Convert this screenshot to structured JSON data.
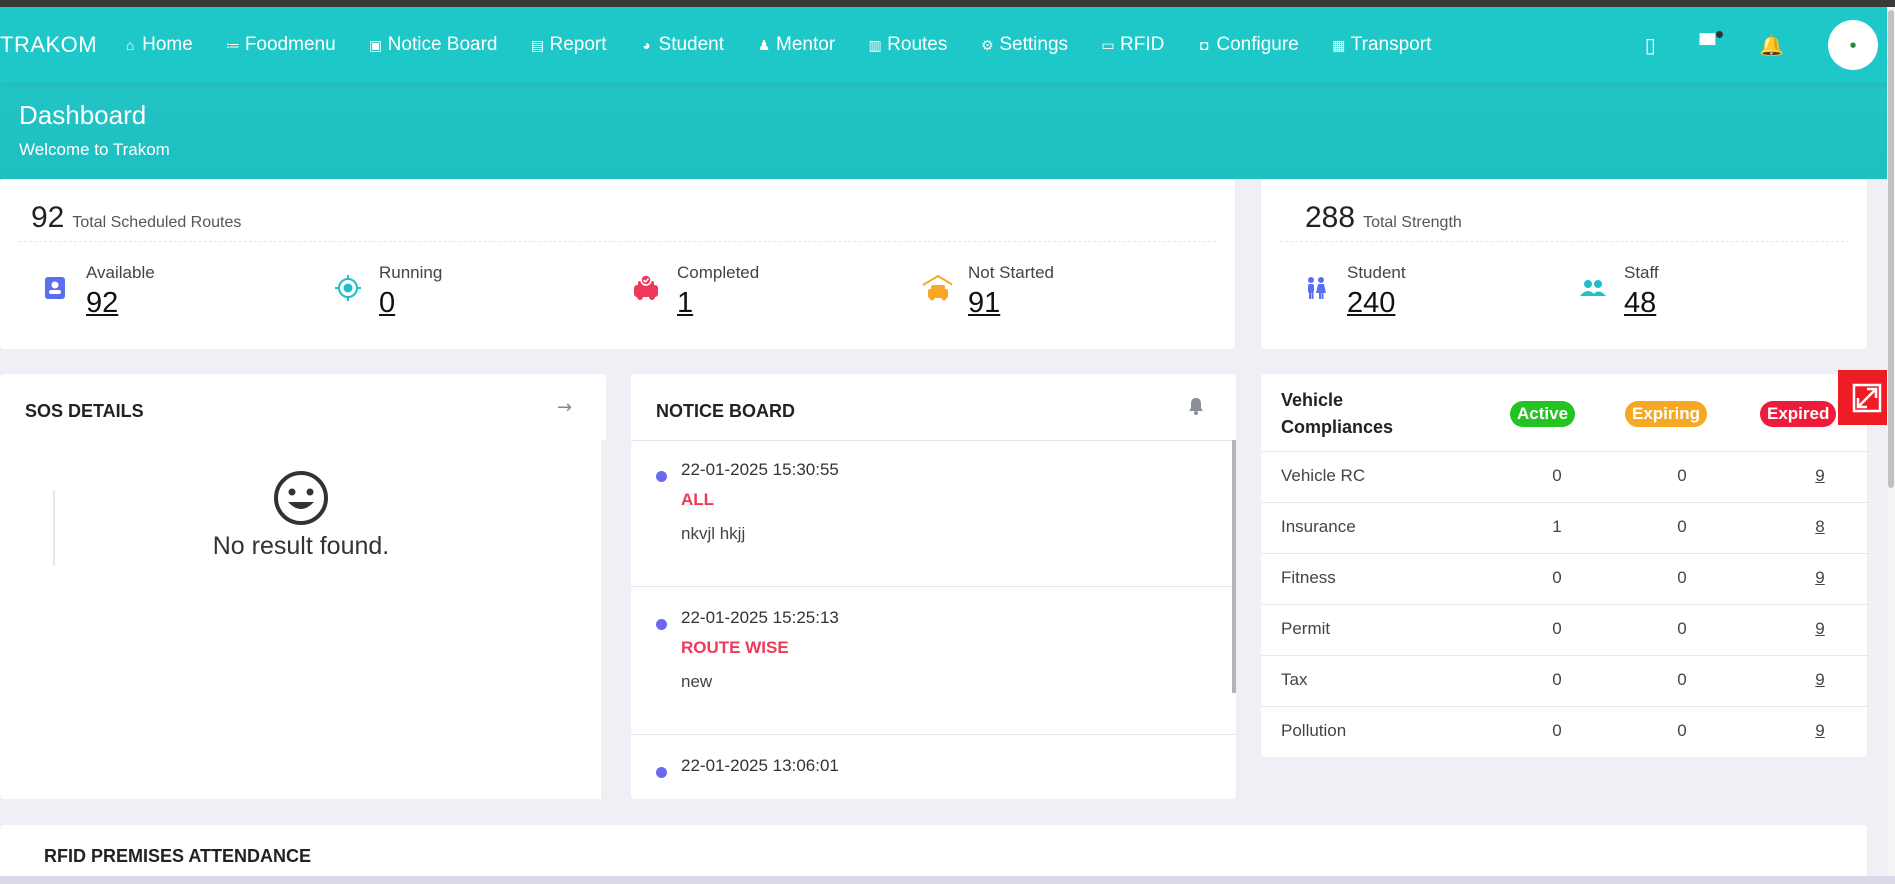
{
  "nav": {
    "brand": "TRAKOM",
    "items": [
      {
        "label": "Home",
        "icon": "home-icon",
        "glyph": "⌂"
      },
      {
        "label": "Foodmenu",
        "icon": "list-icon",
        "glyph": "≔"
      },
      {
        "label": "Notice Board",
        "icon": "id-badge-icon",
        "glyph": "▣"
      },
      {
        "label": "Report",
        "icon": "document-icon",
        "glyph": "▤"
      },
      {
        "label": "Student",
        "icon": "student-icon",
        "glyph": "◕"
      },
      {
        "label": "Mentor",
        "icon": "user-icon",
        "glyph": "♟"
      },
      {
        "label": "Routes",
        "icon": "map-icon",
        "glyph": "▥"
      },
      {
        "label": "Settings",
        "icon": "gear-icon",
        "glyph": "⚙"
      },
      {
        "label": "RFID",
        "icon": "card-icon",
        "glyph": "▭"
      },
      {
        "label": "Configure",
        "icon": "configure-icon",
        "glyph": "◘"
      },
      {
        "label": "Transport",
        "icon": "bus-icon",
        "glyph": "▦"
      }
    ]
  },
  "header": {
    "title": "Dashboard",
    "subtitle": "Welcome to Trakom"
  },
  "routes": {
    "total": "92",
    "total_label": "Total Scheduled Routes",
    "stats": [
      {
        "label": "Available",
        "value": "92",
        "icon": "badge-icon",
        "color": "#5b6ef0"
      },
      {
        "label": "Running",
        "value": "0",
        "icon": "target-icon",
        "color": "#1fc0c7"
      },
      {
        "label": "Completed",
        "value": "1",
        "icon": "car-check-icon",
        "color": "#ee3a5a"
      },
      {
        "label": "Not Started",
        "value": "91",
        "icon": "garage-icon",
        "color": "#f7a823"
      }
    ]
  },
  "strength": {
    "total": "288",
    "total_label": "Total Strength",
    "stats": [
      {
        "label": "Student",
        "value": "240",
        "icon": "students-icon",
        "color": "#5b6ef0"
      },
      {
        "label": "Staff",
        "value": "48",
        "icon": "staff-icon",
        "color": "#1fc0c7"
      }
    ]
  },
  "sos": {
    "title": "SOS DETAILS",
    "empty": "No result found."
  },
  "notice": {
    "title": "NOTICE BOARD",
    "items": [
      {
        "time": "22-01-2025 15:30:55",
        "tag": "ALL",
        "text": "nkvjl hkjj"
      },
      {
        "time": "22-01-2025 15:25:13",
        "tag": "ROUTE WISE",
        "text": "new"
      },
      {
        "time": "22-01-2025 13:06:01",
        "tag": "",
        "text": ""
      }
    ]
  },
  "compliance": {
    "title_line1": "Vehicle",
    "title_line2": "Compliances",
    "headers": [
      {
        "label": "Active",
        "color": "#22c322"
      },
      {
        "label": "Expiring",
        "color": "#f7a823"
      },
      {
        "label": "Expired",
        "color": "#ee1c3a"
      }
    ],
    "rows": [
      {
        "name": "Vehicle RC",
        "active": "0",
        "expiring": "0",
        "expired": "9"
      },
      {
        "name": "Insurance",
        "active": "1",
        "expiring": "0",
        "expired": "8"
      },
      {
        "name": "Fitness",
        "active": "0",
        "expiring": "0",
        "expired": "9"
      },
      {
        "name": "Permit",
        "active": "0",
        "expiring": "0",
        "expired": "9"
      },
      {
        "name": "Tax",
        "active": "0",
        "expiring": "0",
        "expired": "9"
      },
      {
        "name": "Pollution",
        "active": "0",
        "expiring": "0",
        "expired": "9"
      }
    ]
  },
  "rfid": {
    "title": "RFID PREMISES ATTENDANCE"
  },
  "colors": {
    "primary": "#1fc0c7",
    "danger": "#ee1c24"
  }
}
